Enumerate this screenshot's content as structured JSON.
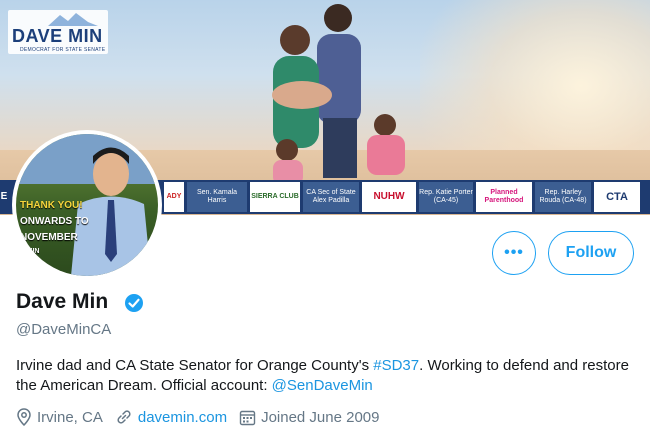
{
  "banner": {
    "logo_name": "DAVE MIN",
    "logo_tagline": "DEMOCRAT FOR STATE SENATE",
    "endorsements": [
      "E",
      "ADY",
      "Sen. Kamala Harris",
      "SIERRA CLUB",
      "CA Sec of State Alex Padilla",
      "NUHW",
      "Rep. Katie Porter (CA-45)",
      "Planned Parenthood",
      "Rep. Harley Rouda (CA-48)",
      "CTA"
    ]
  },
  "avatar": {
    "caption_line1": "THANK YOU!",
    "caption_line2": "ONWARDS TO",
    "caption_line3": "NOVEMBER",
    "caption_line4": "E MIN"
  },
  "actions": {
    "more_label": "•••",
    "follow_label": "Follow"
  },
  "profile": {
    "name": "Dave Min",
    "handle": "@DaveMinCA",
    "bio_part1": "Irvine dad and CA State Senator for Orange County's ",
    "bio_hashtag": "#SD37",
    "bio_part2": ". Working to defend and restore the American Dream. Official account: ",
    "bio_mention": "@SenDaveMin",
    "location": "Irvine, CA",
    "website": "davemin.com",
    "joined": "Joined June 2009"
  },
  "colors": {
    "accent": "#1da1f2",
    "link": "#1b95e0",
    "secondary_text": "#657786",
    "banner_strip": "#1e3b70"
  },
  "icons": [
    "location-icon",
    "link-icon",
    "calendar-icon",
    "verified-badge-icon",
    "more-icon"
  ]
}
